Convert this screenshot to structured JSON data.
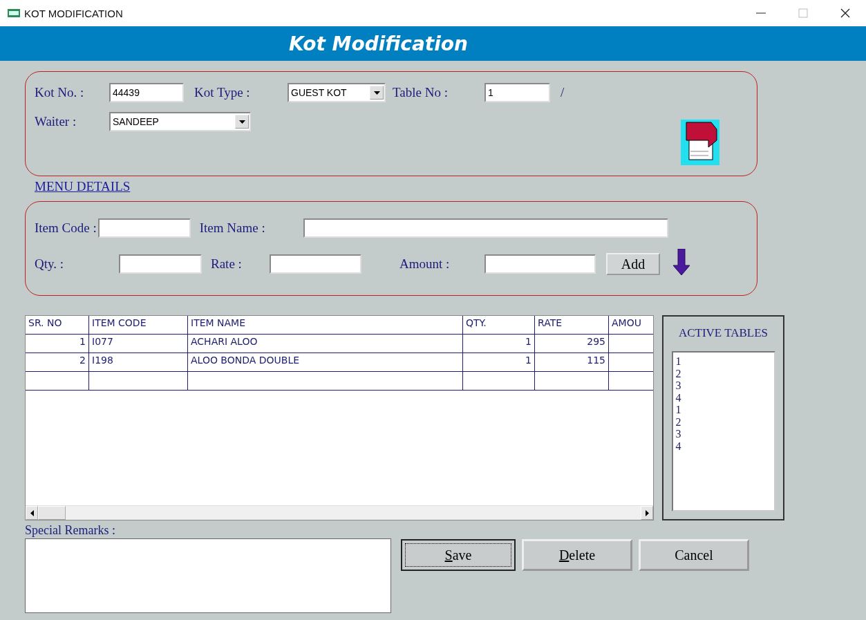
{
  "window": {
    "title": "KOT MODIFICATION"
  },
  "header": {
    "title": "Kot Modification"
  },
  "kot": {
    "kot_no": {
      "label": "Kot No. :",
      "value": "44439"
    },
    "kot_type": {
      "label": "Kot Type :",
      "value": "GUEST KOT"
    },
    "table_no": {
      "label": "Table No :",
      "value": "1",
      "separator": "/"
    },
    "waiter": {
      "label": "Waiter :",
      "value": "SANDEEP"
    }
  },
  "menu_details_link": "MENU DETAILS",
  "item_entry": {
    "item_code": {
      "label": "Item Code :"
    },
    "item_name": {
      "label": "Item Name :"
    },
    "qty": {
      "label": "Qty. :"
    },
    "rate": {
      "label": "Rate :"
    },
    "amount": {
      "label": "Amount :"
    },
    "add_button": "Add"
  },
  "grid": {
    "columns": [
      "SR. NO",
      "ITEM CODE",
      "ITEM NAME",
      "QTY.",
      "RATE",
      "AMOU"
    ],
    "rows": [
      [
        "1",
        "I077",
        "ACHARI ALOO",
        "1",
        "295"
      ],
      [
        "2",
        "I198",
        "ALOO BONDA DOUBLE",
        "1",
        "115"
      ]
    ]
  },
  "active_tables": {
    "title": "ACTIVE TABLES",
    "items": [
      "1",
      "2",
      "3",
      "4",
      "1",
      "2",
      "3",
      "4"
    ]
  },
  "remarks": {
    "label": "Special Remarks :"
  },
  "buttons": [
    {
      "label": "Save",
      "underline_first": true,
      "focused": true
    },
    {
      "label": "Delete",
      "underline_first": true,
      "focused": false
    },
    {
      "label": "Cancel",
      "underline_first": false,
      "focused": false
    }
  ]
}
